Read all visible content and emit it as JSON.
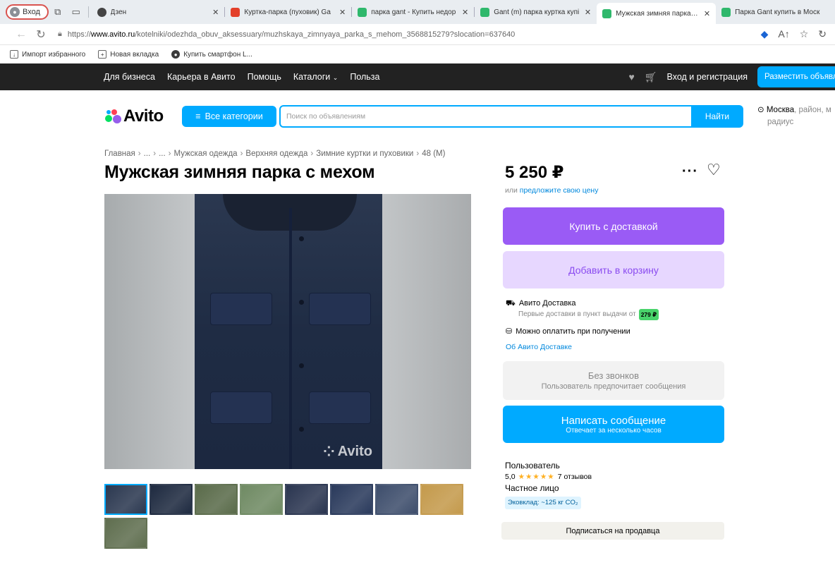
{
  "browser": {
    "login_label": "Вход",
    "tabs": [
      {
        "label": "Дзен",
        "color": "#444444"
      },
      {
        "label": "Куртка-парка (пуховик) Ga",
        "color": "#e3402a"
      },
      {
        "label": "парка gant - Купить недор",
        "color": "#2fb86c"
      },
      {
        "label": "Gant (m) парка куртка купі",
        "color": "#2fb86c"
      },
      {
        "label": "Мужская зимняя парка с м",
        "color": "#2fb86c"
      },
      {
        "label": "Парка Gant купить в Моск",
        "color": "#2fb86c"
      }
    ],
    "url_prefix": "https://",
    "url_host": "www.avito.ru",
    "url_path": "/kotelniki/odezhda_obuv_aksessuary/muzhskaya_zimnyaya_parka_s_mehom_3568815279?slocation=637640",
    "bookmarks": [
      "Импорт избранного",
      "Новая вкладка",
      "Купить смартфон L..."
    ]
  },
  "topnav": {
    "links": [
      "Для бизнеса",
      "Карьера в Авито",
      "Помощь",
      "Каталоги",
      "Польза"
    ],
    "login": "Вход и регистрация",
    "post_ad": "Разместить объявление"
  },
  "search": {
    "logo": "Avito",
    "categories": "Все категории",
    "placeholder": "Поиск по объявлениям",
    "find": "Найти",
    "city": "Москва",
    "region_hint": ", район, м",
    "radius": "радиус"
  },
  "breadcrumb": [
    "Главная",
    "...",
    "...",
    "Мужская одежда",
    "Верхняя одежда",
    "Зимние куртки и пуховики",
    "48 (M)"
  ],
  "listing": {
    "title": "Мужская зимняя парка с мехом",
    "price": "5 250 ₽",
    "offer_prefix": "или",
    "offer_link": "предложите свою цену",
    "watermark": "Avito",
    "thumb_colors": [
      "#2b3850",
      "#1e2a40",
      "#5a6b4a",
      "#6f8a63",
      "#2a3550",
      "#2a3a5c",
      "#3e4e6c",
      "#c49a4c",
      "#5f6e4f"
    ]
  },
  "actions": {
    "buy": "Купить с доставкой",
    "add_cart": "Добавить в корзину",
    "delivery_title": "Авито Доставка",
    "delivery_sub": "Первые доставки в пункт выдачи от",
    "delivery_price": "279 ₽",
    "pay_on_receipt": "Можно оплатить при получении",
    "about_delivery": "Об Авито Доставке",
    "no_calls": "Без звонков",
    "no_calls_sub": "Пользователь предпочитает сообщения",
    "message": "Написать сообщение",
    "message_sub": "Отвечает за несколько часов"
  },
  "seller": {
    "name": "Пользователь",
    "rating": "5,0",
    "stars": "★★★★★",
    "reviews": "7 отзывов",
    "type": "Частное лицо",
    "eco": "Эковклад: ~125 кг CO₂",
    "subscribe": "Подписаться на продавца"
  }
}
